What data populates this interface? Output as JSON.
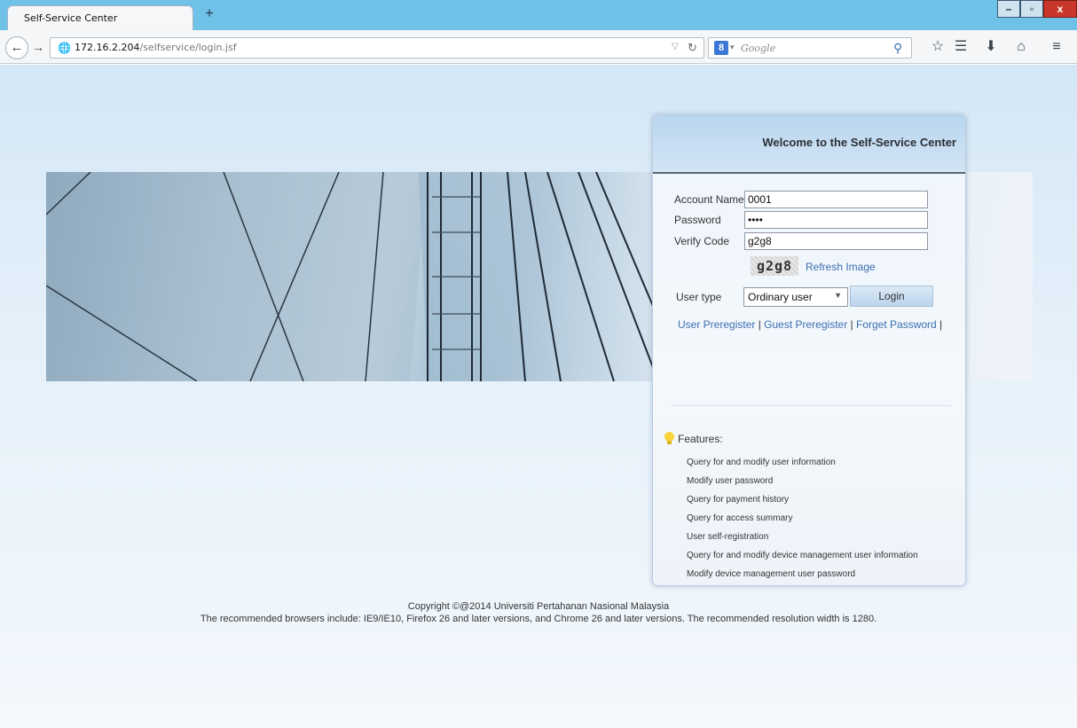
{
  "browser": {
    "tab_title": "Self-Service Center",
    "new_tab_label": "+",
    "url_host": "172.16.2.204",
    "url_path": "/selfservice/login.jsf",
    "search_engine_letter": "8",
    "search_placeholder": "Google",
    "window_buttons": {
      "minimize": "–",
      "maximize": "▫",
      "close": "x"
    }
  },
  "login": {
    "title": "Welcome to the Self-Service Center",
    "account_label": "Account Name",
    "account_value": "0001",
    "password_label": "Password",
    "password_value": "••••",
    "verify_label": "Verify Code",
    "verify_value": "g2g8",
    "captcha_text": "g2g8",
    "refresh_label": "Refresh Image",
    "user_type_label": "User type",
    "user_type_value": "Ordinary user",
    "login_label": "Login",
    "links": {
      "user_preregister": "User Preregister",
      "guest_preregister": "Guest Preregister",
      "forget_password": "Forget Password"
    }
  },
  "features": {
    "title": "Features:",
    "items": [
      "Query for and modify user information",
      "Modify user password",
      "Query for payment history",
      "Query for access summary",
      "User self-registration",
      "Query for and modify device management user information",
      "Modify device management user password"
    ]
  },
  "footer": {
    "copyright": "Copyright ©@2014 Universiti Pertahanan Nasional Malaysia",
    "recommendation": "The recommended browsers include: IE9/IE10, Firefox 26 and later versions, and Chrome 26 and later versions. The recommended resolution width is 1280."
  },
  "colors": {
    "link": "#3c6fb0",
    "titlebar": "#6fc1e8",
    "close_button": "#c9372c"
  },
  "icons": [
    "back-arrow-icon",
    "forward-arrow-icon",
    "globe-icon",
    "reload-icon",
    "search-icon",
    "star-icon",
    "bookmarks-icon",
    "download-icon",
    "home-icon",
    "menu-icon",
    "lightbulb-icon",
    "dropdown-caret-icon"
  ]
}
